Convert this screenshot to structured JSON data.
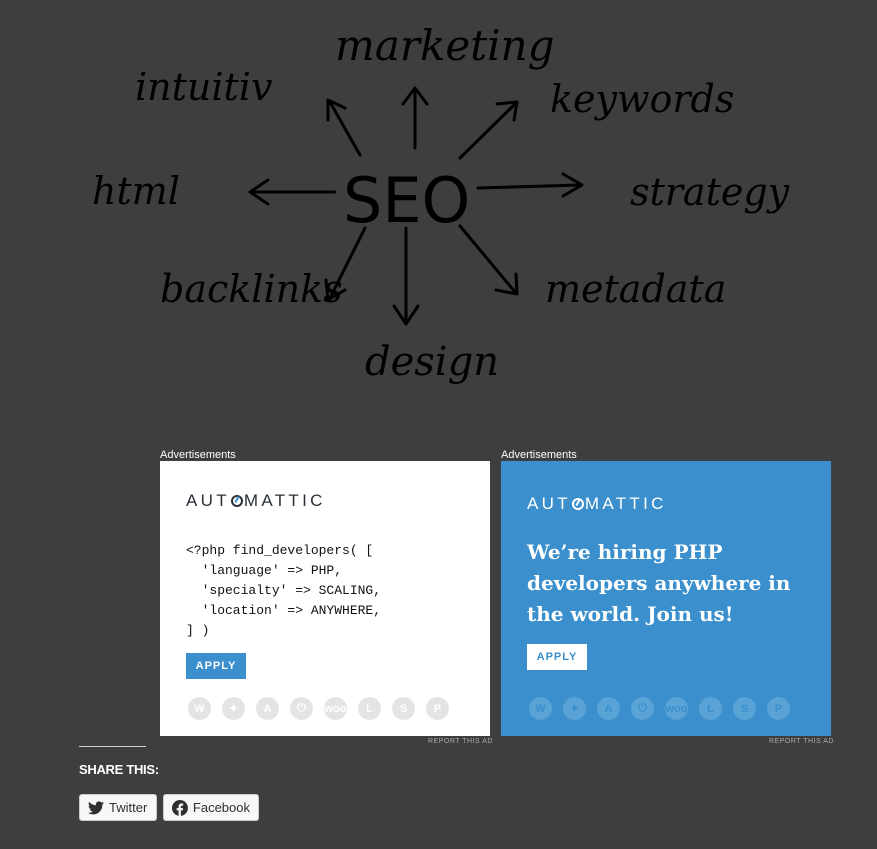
{
  "sketch": {
    "center": "SEO",
    "words": {
      "marketing": "marketing",
      "intuitive": "intuitiv",
      "keywords": "keywords",
      "html": "html",
      "strategy": "strategy",
      "backlinks": "backlinks",
      "metadata": "metadata",
      "design": "design"
    }
  },
  "ads": [
    {
      "label": "Advertisements",
      "brand_left": "AUT",
      "brand_right": "MATTIC",
      "code": "<?php find_developers( [\n  'language' => PHP,\n  'specialty' => SCALING,\n  'location' => ANYWHERE,\n] )",
      "button": "APPLY",
      "report": "REPORT THIS AD",
      "icons": [
        "W",
        "✦",
        "A",
        "⏻",
        "woo",
        "L",
        "S",
        "P"
      ]
    },
    {
      "label": "Advertisements",
      "brand_left": "AUT",
      "brand_right": "MATTIC",
      "headline": "We’re hiring PHP developers anywhere in the world. Join us!",
      "button": "APPLY",
      "report": "REPORT THIS AD",
      "icons": [
        "W",
        "✦",
        "A",
        "⏻",
        "woo",
        "L",
        "S",
        "P"
      ]
    }
  ],
  "share": {
    "title": "SHARE THIS:",
    "buttons": [
      {
        "label": "Twitter",
        "icon": "twitter-icon"
      },
      {
        "label": "Facebook",
        "icon": "facebook-icon"
      }
    ]
  },
  "colors": {
    "background": "#3c3e40",
    "ad_blue": "#3a8fcc",
    "text_white": "#ffffff"
  }
}
